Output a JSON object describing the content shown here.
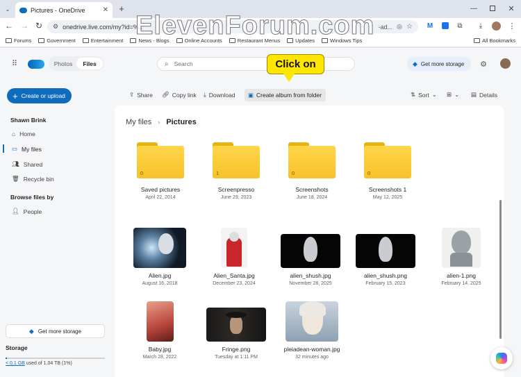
{
  "browser": {
    "tab_title": "Pictures - OneDrive",
    "url": "onedrive.live.com/my?id=%2",
    "url_tail": "-ad...",
    "bookmarks": [
      "Forums",
      "Government",
      "Entertainment",
      "News - Blogs",
      "Online Accounts",
      "Restaurant Menus",
      "Updates",
      "Windows Tips"
    ],
    "all_bookmarks": "All Bookmarks"
  },
  "watermark": "ElevenForum.com",
  "header": {
    "tabs": [
      "Photos",
      "Files"
    ],
    "search_placeholder": "Search",
    "storage_button": "Get more storage"
  },
  "callout": "Click on",
  "sidebar": {
    "create_button": "Create or upload",
    "user": "Shawn Brink",
    "items": [
      "Home",
      "My files",
      "Shared",
      "Recycle bin"
    ],
    "browse_heading": "Browse files by",
    "browse_items": [
      "People"
    ],
    "get_storage": "Get more storage",
    "storage_heading": "Storage",
    "storage_used": "< 0.1 GB",
    "storage_of": " used of 1.04 TB (1%)"
  },
  "commands": {
    "share": "Share",
    "copy_link": "Copy link",
    "download": "Download",
    "create_album": "Create album from folder",
    "sort": "Sort",
    "details": "Details"
  },
  "breadcrumb": {
    "root": "My files",
    "current": "Pictures"
  },
  "folders": [
    {
      "name": "Saved pictures",
      "date": "April 22, 2014",
      "count": "0"
    },
    {
      "name": "Screenpresso",
      "date": "June 29, 2023",
      "count": "1"
    },
    {
      "name": "Screenshots",
      "date": "June 18, 2024",
      "count": "0"
    },
    {
      "name": "Screenshots 1",
      "date": "May 12, 2025",
      "count": "0"
    }
  ],
  "files_row1": [
    {
      "name": "Alien.jpg",
      "date": "August 16, 2018"
    },
    {
      "name": "Alien_Santa.jpg",
      "date": "December 23, 2024"
    },
    {
      "name": "alien_shush.jpg",
      "date": "November 28, 2025"
    },
    {
      "name": "alien_shush.png",
      "date": "February 15, 2023"
    },
    {
      "name": "alien-1.png",
      "date": "February 14, 2025"
    }
  ],
  "files_row2": [
    {
      "name": "Baby.jpg",
      "date": "March 28, 2022"
    },
    {
      "name": "Fringe.png",
      "date": "Tuesday at 1:11 PM"
    },
    {
      "name": "pleiadean-woman.jpg",
      "date": "32 minutes ago"
    }
  ],
  "colors": {
    "accent": "#0f6cbd",
    "callout": "#ffe600",
    "folder": "#f6c22a"
  }
}
